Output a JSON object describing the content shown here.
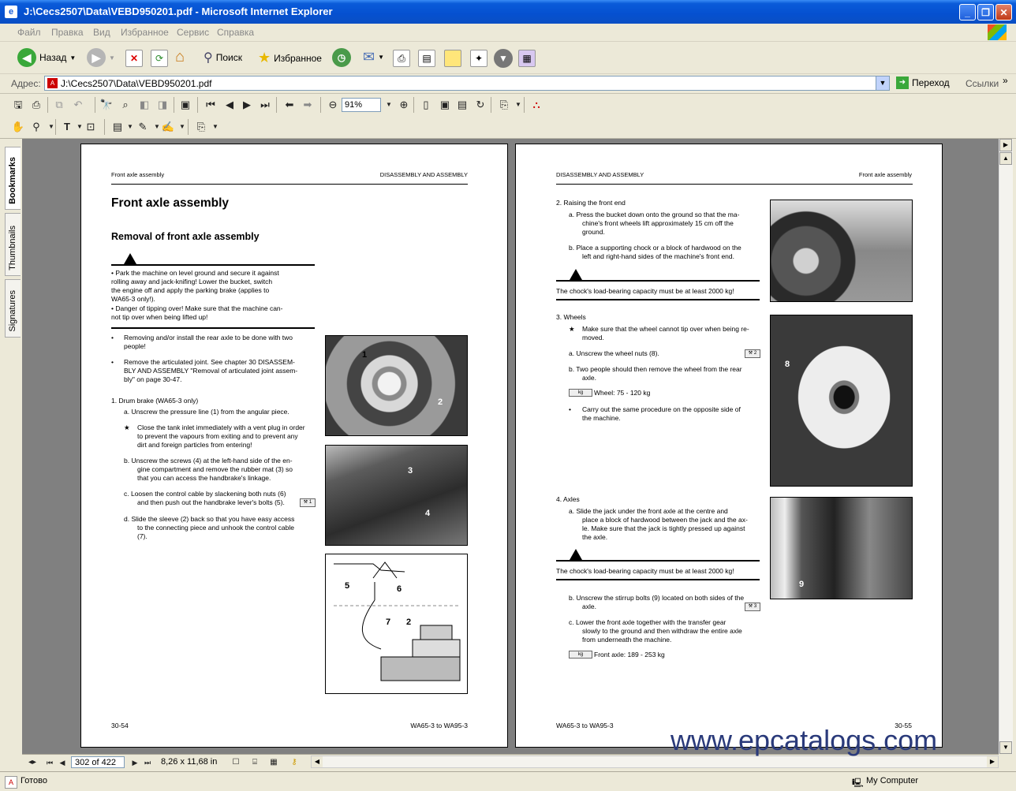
{
  "window": {
    "title": "J:\\Cecs2507\\Data\\VEBD950201.pdf - Microsoft Internet Explorer",
    "minimize": "_",
    "maximize": "❐",
    "close": "✕"
  },
  "menu": [
    "Файл",
    "Правка",
    "Вид",
    "Избранное",
    "Сервис",
    "Справка"
  ],
  "toolbar": {
    "back_label": "Назад",
    "search_label": "Поиск",
    "favorites_label": "Избранное"
  },
  "address": {
    "label": "Адрес:",
    "value": "J:\\Cecs2507\\Data\\VEBD950201.pdf",
    "go_label": "Переход",
    "links_label": "Ссылки"
  },
  "acrobat": {
    "zoom": "91%"
  },
  "left_tabs": [
    "Bookmarks",
    "Thumbnails",
    "Signatures"
  ],
  "page_left": {
    "header_left": "Front axle assembly",
    "header_right": "DISASSEMBLY AND ASSEMBLY",
    "title": "Front axle assembly",
    "subtitle": "Removal of front axle assembly",
    "warning1": "• Park the machine on level ground and secure it against",
    "warning2": "   rolling away and jack-knifing! Lower the bucket, switch",
    "warning3": "   the engine off and apply the parking brake (applies to",
    "warning4": "   WA65-3 only!).",
    "warning5": "• Danger of tipping over! Make sure that the machine can-",
    "warning6": "   not tip over when being lifted up!",
    "b1a": "Removing and/or install the rear axle to be done with two",
    "b1b": "people!",
    "b2a": "Remove the articulated joint. See chapter 30 DISASSEM-",
    "b2b": "BLY AND ASSEMBLY \"Removal of articulated joint assem-",
    "b2c": "bly\" on page 30-47.",
    "s1": "1.    Drum brake (WA65-3 only)",
    "s1a": "a.    Unscrew the pressure line (1) from the angular piece.",
    "s1star1": "Close the tank inlet immediately with a vent plug in order",
    "s1star2": "to prevent the vapours from exiting and to prevent any",
    "s1star3": "dirt and foreign particles from entering!",
    "s1b1": "b.    Unscrew the screws (4) at the left-hand side of the en-",
    "s1b2": "gine compartment and remove the rubber mat (3) so",
    "s1b3": "that you can access the handbrake's linkage.",
    "s1c1": "c.    Loosen the control cable by slackening both nuts (6)",
    "s1c2": "and then push out the handbrake lever's bolts (5).",
    "s1d1": "d.    Slide the sleeve (2) back so that you have easy access",
    "s1d2": "to the connecting piece and unhook the control cable",
    "s1d3": "(7).",
    "footer_left": "30-54",
    "footer_right": "WA65-3 to WA95-3",
    "callouts": [
      "1",
      "2",
      "3",
      "4",
      "5",
      "6",
      "7",
      "2"
    ]
  },
  "page_right": {
    "header_left": "DISASSEMBLY AND ASSEMBLY",
    "header_right": "Front axle assembly",
    "s2": "2.    Raising the front end",
    "s2a1": "a.    Press the bucket down onto the ground so that the ma-",
    "s2a2": "chine's front wheels lift approximately 15 cm off the",
    "s2a3": "ground.",
    "s2b1": "b.    Place a supporting chock or a block of hardwood on the",
    "s2b2": "left and right-hand sides of the machine's front end.",
    "warn_chock": "The chock's load-bearing capacity must be at least 2000 kg!",
    "s3": "3.    Wheels",
    "s3star1": "Make sure that the wheel cannot tip over when being re-",
    "s3star2": "moved.",
    "s3a": "a.    Unscrew the wheel nuts (8).",
    "s3b1": "b.    Two people should then remove the wheel from the rear",
    "s3b2": "axle.",
    "s3w": "Wheel: 75 - 120 kg",
    "s3d1": "Carry out the same procedure on the opposite side of",
    "s3d2": "the machine.",
    "s4": "4.    Axles",
    "s4a1": "a.    Slide the jack under the front axle at the centre and",
    "s4a2": "place a block of hardwood between the jack and the ax-",
    "s4a3": "le. Make sure that the jack is tightly pressed up against",
    "s4a4": "the axle.",
    "warn_chock2": "The chock's load-bearing capacity must be at least 2000 kg!",
    "s4b1": "b.    Unscrew the stirrup bolts (9) located on both sides of the",
    "s4b2": "axle.",
    "s4c1": "c.    Lower the front axle together with the transfer gear",
    "s4c2": "slowly to the ground and then withdraw the entire axle",
    "s4c3": "from underneath the machine.",
    "s4w": "Front axle: 189 - 253 kg",
    "footer_left": "WA65-3 to WA95-3",
    "footer_right": "30-55",
    "callouts": [
      "8",
      "9"
    ]
  },
  "nav": {
    "page": "302 of 422",
    "size": "8,26 x 11,68 in"
  },
  "status": {
    "left": "Готово",
    "right": "My Computer"
  },
  "watermark": "www.epcatalogs.com"
}
